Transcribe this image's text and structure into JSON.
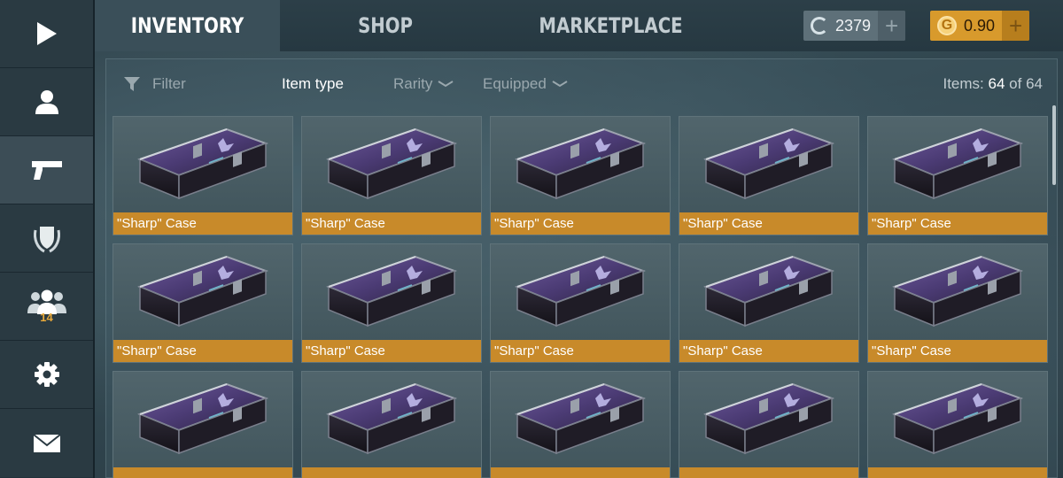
{
  "sidebar": {
    "items": [
      {
        "name": "play",
        "icon": "play-icon"
      },
      {
        "name": "profile",
        "icon": "person-icon"
      },
      {
        "name": "weapons",
        "icon": "pistol-icon",
        "active": true
      },
      {
        "name": "ranks",
        "icon": "shield-laurel-icon"
      },
      {
        "name": "friends",
        "icon": "group-icon",
        "badge": "14"
      },
      {
        "name": "settings",
        "icon": "gear-icon"
      },
      {
        "name": "mail",
        "icon": "envelope-icon"
      }
    ]
  },
  "tabs": {
    "inventory": "INVENTORY",
    "shop": "SHOP",
    "marketplace": "MARKETPLACE"
  },
  "currency": {
    "credits": "2379",
    "gold": "0.90",
    "credits_symbol": "C",
    "gold_symbol": "G",
    "plus": "+"
  },
  "filters": {
    "filter": "Filter",
    "item_type": "Item type",
    "rarity": "Rarity",
    "equipped": "Equipped",
    "items_prefix": "Items:",
    "items_shown": "64",
    "items_of": "of",
    "items_total": "64"
  },
  "grid": {
    "items": [
      {
        "label": "\"Sharp\" Case"
      },
      {
        "label": "\"Sharp\" Case"
      },
      {
        "label": "\"Sharp\" Case"
      },
      {
        "label": "\"Sharp\" Case"
      },
      {
        "label": "\"Sharp\" Case"
      },
      {
        "label": "\"Sharp\" Case"
      },
      {
        "label": "\"Sharp\" Case"
      },
      {
        "label": "\"Sharp\" Case"
      },
      {
        "label": "\"Sharp\" Case"
      },
      {
        "label": "\"Sharp\" Case"
      },
      {
        "label": ""
      },
      {
        "label": ""
      },
      {
        "label": ""
      },
      {
        "label": ""
      },
      {
        "label": ""
      }
    ]
  },
  "colors": {
    "accent_gold": "#c88a2a",
    "gold_currency": "#d89a2c",
    "badge": "#e8a93a"
  }
}
